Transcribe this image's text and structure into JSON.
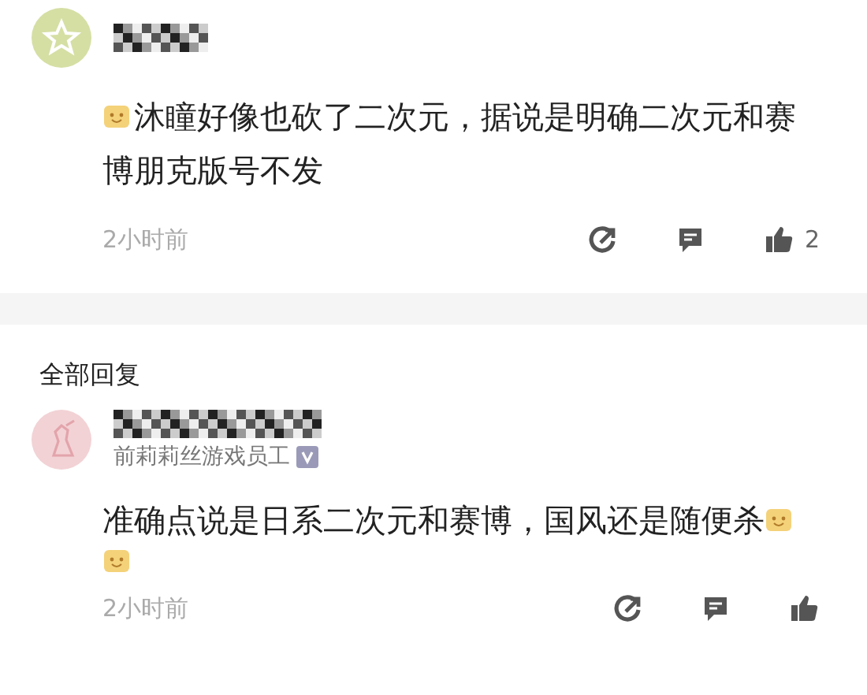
{
  "comments": [
    {
      "avatar": {
        "color": "#d5dfa4",
        "kind": "star"
      },
      "lines": [
        [
          {
            "kind": "emoji"
          },
          {
            "kind": "text",
            "text": "沐瞳好像也砍了二次元，据说是明确二次元和赛"
          }
        ],
        [
          {
            "kind": "text",
            "text": "博朋克版号不发"
          }
        ]
      ],
      "time": "2小时前",
      "likes": "2"
    },
    {
      "avatar": {
        "color": "#f2d2d5",
        "kind": "figure"
      },
      "subtitle": "前莉莉丝游戏员工",
      "verified": true,
      "lines": [
        [
          {
            "kind": "text",
            "text": "准确点说是日系二次元和赛博，国风还是随便杀"
          },
          {
            "kind": "emoji"
          }
        ],
        [
          {
            "kind": "emoji"
          }
        ]
      ],
      "time": "2小时前"
    }
  ],
  "section_title": "全部回复"
}
